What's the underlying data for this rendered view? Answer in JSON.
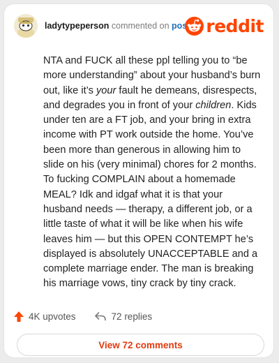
{
  "comment": {
    "username": "ladytypeperson",
    "action": "commented on",
    "post_link": "post",
    "body_parts": [
      {
        "t": "NTA and FUCK all these ppl telling you to “be more understanding” about your husband’s burn out, like it’s ",
        "i": false
      },
      {
        "t": "your",
        "i": true
      },
      {
        "t": " fault he demeans, disrespects, and degrades you in front of your ",
        "i": false
      },
      {
        "t": "children",
        "i": true
      },
      {
        "t": ". Kids under ten are a FT job, and your bring in extra income with PT work outside the home. You’ve been more than generous in allowing him to slide on his (very minimal) chores for 2 months. To fucking COMPLAIN about a homemade MEAL? Idk and idgaf what it is that your husband needs — therapy, a different job, or a little taste of what it will be like when his wife leaves him — but this OPEN CONTEMPT he’s displayed is absolutely UNACCEPTABLE and a complete marriage ender. The man is breaking his marriage vows, tiny crack by tiny crack.",
        "i": false
      }
    ],
    "upvotes": "4K upvotes",
    "replies": "72 replies",
    "view_button": "View 72 comments"
  },
  "brand": {
    "name": "reddit",
    "color": "#ff4500"
  },
  "icons": {
    "upvote": "upvote-arrow-icon",
    "reply": "reply-arrow-icon",
    "logo": "reddit-snoo-icon"
  }
}
